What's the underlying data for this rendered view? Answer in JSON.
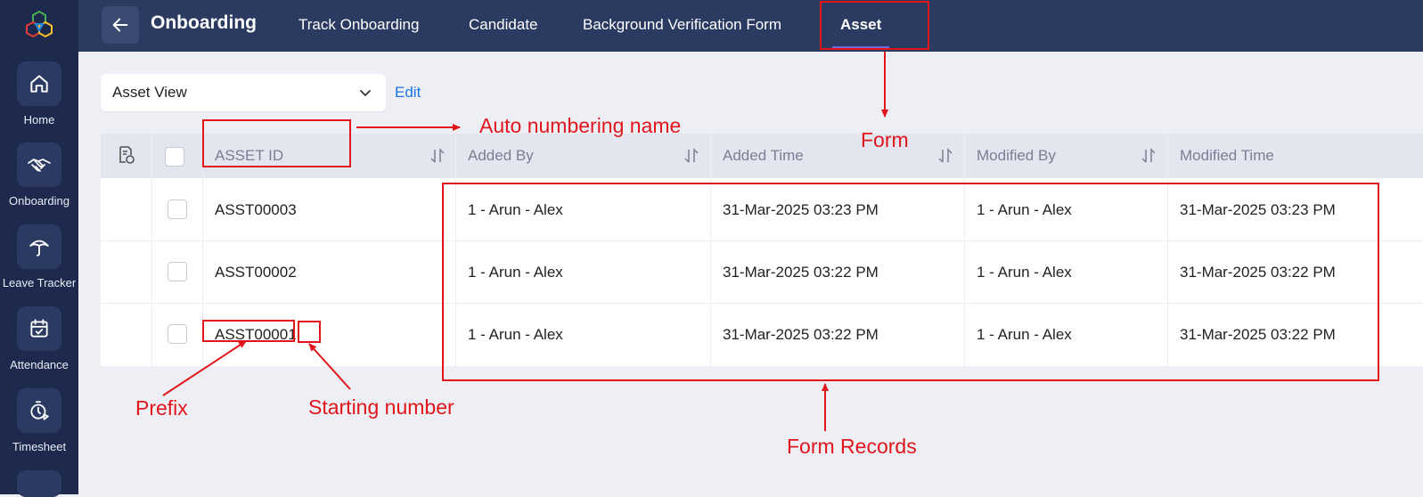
{
  "sidebar": {
    "items": [
      {
        "label": "Home",
        "icon": "home-icon"
      },
      {
        "label": "Onboarding",
        "icon": "handshake-icon"
      },
      {
        "label": "Leave Tracker",
        "icon": "umbrella-icon"
      },
      {
        "label": "Attendance",
        "icon": "calendar-check-icon"
      },
      {
        "label": "Timesheet",
        "icon": "timer-icon"
      }
    ]
  },
  "header": {
    "title": "Onboarding",
    "tabs": [
      {
        "label": "Track Onboarding"
      },
      {
        "label": "Candidate"
      },
      {
        "label": "Background Verification Form"
      },
      {
        "label": "Asset",
        "active": true
      }
    ]
  },
  "toolbar": {
    "view_select": "Asset View",
    "edit_label": "Edit"
  },
  "table": {
    "columns": [
      "ASSET ID",
      "Added By",
      "Added Time",
      "Modified By",
      "Modified Time"
    ],
    "rows": [
      {
        "asset_id": "ASST00003",
        "added_by": "1 - Arun - Alex",
        "added_time": "31-Mar-2025 03:23 PM",
        "modified_by": "1 - Arun - Alex",
        "modified_time": "31-Mar-2025 03:23 PM"
      },
      {
        "asset_id": "ASST00002",
        "added_by": "1 - Arun - Alex",
        "added_time": "31-Mar-2025 03:22 PM",
        "modified_by": "1 - Arun - Alex",
        "modified_time": "31-Mar-2025 03:22 PM"
      },
      {
        "asset_id": "ASST00001",
        "added_by": "1 - Arun - Alex",
        "added_time": "31-Mar-2025 03:22 PM",
        "modified_by": "1 - Arun - Alex",
        "modified_time": "31-Mar-2025 03:22 PM"
      }
    ]
  },
  "annotations": {
    "auto_numbering_name": "Auto numbering name",
    "form": "Form",
    "prefix": "Prefix",
    "starting_number": "Starting number",
    "form_records": "Form Records"
  },
  "colors": {
    "sidebar_bg": "#1d2a4e",
    "topbar_bg": "#2a3a61",
    "annotation_red": "#e0161c",
    "link_blue": "#1a73e8",
    "tab_underline": "#7b68d9"
  }
}
